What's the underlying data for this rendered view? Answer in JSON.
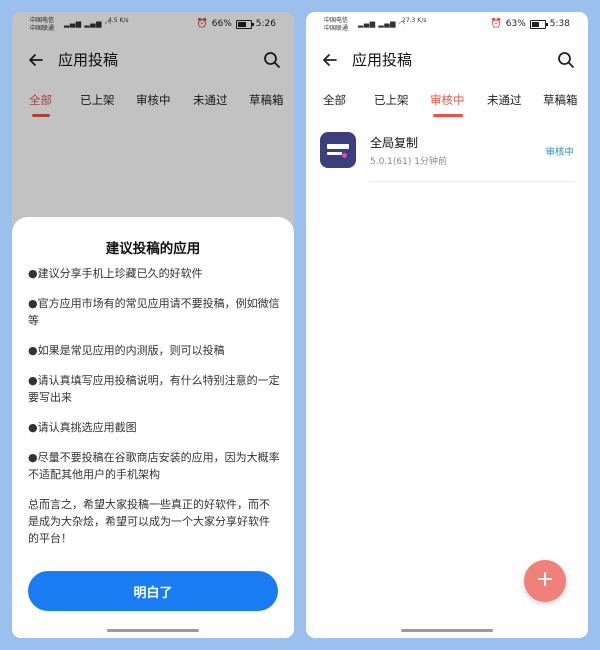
{
  "left": {
    "status": {
      "carrier_line1": "中国电信",
      "carrier_line2": "中国联通",
      "speed": "4.5 K/s",
      "battery": "66%",
      "battery_level": 0.66,
      "time": "5:26"
    },
    "appbar": {
      "title": "应用投稿"
    },
    "tabs": [
      "全部",
      "已上架",
      "审核中",
      "未通过",
      "草稿箱"
    ],
    "active_tab_index": 0,
    "sheet": {
      "title": "建议投稿的应用",
      "items": [
        "●建议分享手机上珍藏已久的好软件",
        "●官方应用市场有的常见应用请不要投稿，例如微信等",
        "●如果是常见应用的内测版，则可以投稿",
        "●请认真填写应用投稿说明，有什么特别注意的一定要写出来",
        "●请认真挑选应用截图",
        "●尽量不要投稿在谷歌商店安装的应用，因为大概率不适配其他用户的手机架构"
      ],
      "summary": "总而言之，希望大家投稿一些真正的好软件，而不是成为大杂烩，希望可以成为一个大家分享好软件的平台！",
      "button_label": "明白了"
    }
  },
  "right": {
    "status": {
      "carrier_line1": "中国电信",
      "carrier_line2": "中国联通",
      "speed": "27.3 K/s",
      "battery": "63%",
      "battery_level": 0.63,
      "time": "5:38"
    },
    "appbar": {
      "title": "应用投稿"
    },
    "tabs": [
      "全部",
      "已上架",
      "审核中",
      "未通过",
      "草稿箱"
    ],
    "active_tab_index": 2,
    "list": [
      {
        "name": "全局复制",
        "version": "5.0.1(61)",
        "time": "1分钟前",
        "status": "审核中"
      }
    ],
    "fab_symbol": "+"
  },
  "colors": {
    "accent": "#e8524a",
    "primary_button": "#1a7cf3",
    "status_review": "#2a8fb5",
    "background": "#9cc0ee"
  }
}
